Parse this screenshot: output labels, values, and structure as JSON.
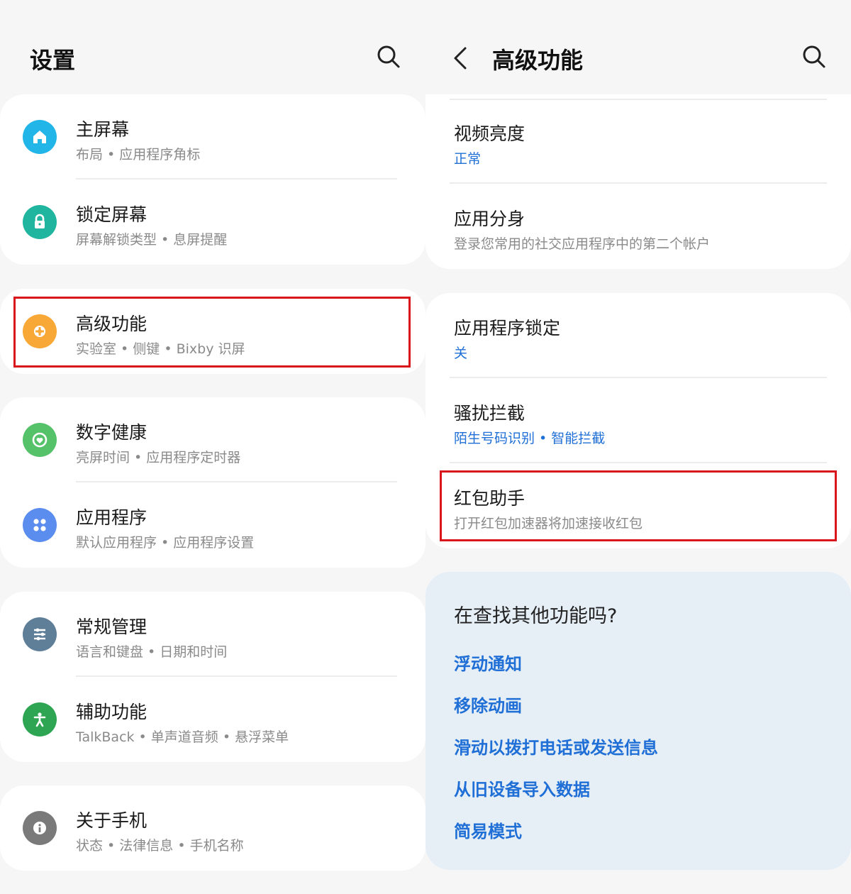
{
  "left_panel": {
    "title": "设置",
    "groups": [
      {
        "items": [
          {
            "title": "主屏幕",
            "subtitle": "布局 • 应用程序角标",
            "icon": "home-icon",
            "color": "#22b5e8"
          },
          {
            "title": "锁定屏幕",
            "subtitle": "屏幕解锁类型 • 息屏提醒",
            "icon": "lock-icon",
            "color": "#20b59e"
          }
        ]
      },
      {
        "items": [
          {
            "title": "高级功能",
            "subtitle": "实验室 • 侧键 • Bixby 识屏",
            "icon": "puzzle-gear-icon",
            "color": "#f7a836"
          }
        ]
      },
      {
        "items": [
          {
            "title": "数字健康",
            "subtitle": "亮屏时间 • 应用程序定时器",
            "icon": "heart-ring-icon",
            "color": "#55c26a"
          },
          {
            "title": "应用程序",
            "subtitle": "默认应用程序 • 应用程序设置",
            "icon": "apps-grid-icon",
            "color": "#5b8dee"
          }
        ]
      },
      {
        "items": [
          {
            "title": "常规管理",
            "subtitle": "语言和键盘 • 日期和时间",
            "icon": "sliders-icon",
            "color": "#5f7f99"
          },
          {
            "title": "辅助功能",
            "subtitle": "TalkBack • 单声道音频 • 悬浮菜单",
            "icon": "accessibility-icon",
            "color": "#2ea553"
          }
        ]
      },
      {
        "items": [
          {
            "title": "关于手机",
            "subtitle": "状态 • 法律信息 • 手机名称",
            "icon": "info-icon",
            "color": "#7a7a7a"
          }
        ]
      }
    ]
  },
  "right_panel": {
    "title": "高级功能",
    "groups": [
      {
        "items": [
          {
            "title": "视频亮度",
            "subtitle": "正常",
            "subtitle_style": "blue"
          },
          {
            "title": "应用分身",
            "subtitle": "登录您常用的社交应用程序中的第二个帐户",
            "subtitle_style": "gray"
          }
        ]
      },
      {
        "items": [
          {
            "title": "应用程序锁定",
            "subtitle": "关",
            "subtitle_style": "blue"
          },
          {
            "title": "骚扰拦截",
            "subtitle": "陌生号码识别 • 智能拦截",
            "subtitle_style": "blue"
          },
          {
            "title": "红包助手",
            "subtitle": "打开红包加速器将加速接收红包",
            "subtitle_style": "gray"
          }
        ]
      }
    ],
    "suggestions": {
      "title": "在查找其他功能吗?",
      "links": [
        "浮动通知",
        "移除动画",
        "滑动以拨打电话或发送信息",
        "从旧设备导入数据",
        "简易模式"
      ]
    }
  },
  "colors": {
    "accent": "#1f6fd6",
    "highlight": "#d9161c",
    "background": "#f6f6f6",
    "card": "#ffffff",
    "suggest_bg": "#e6eef6"
  }
}
